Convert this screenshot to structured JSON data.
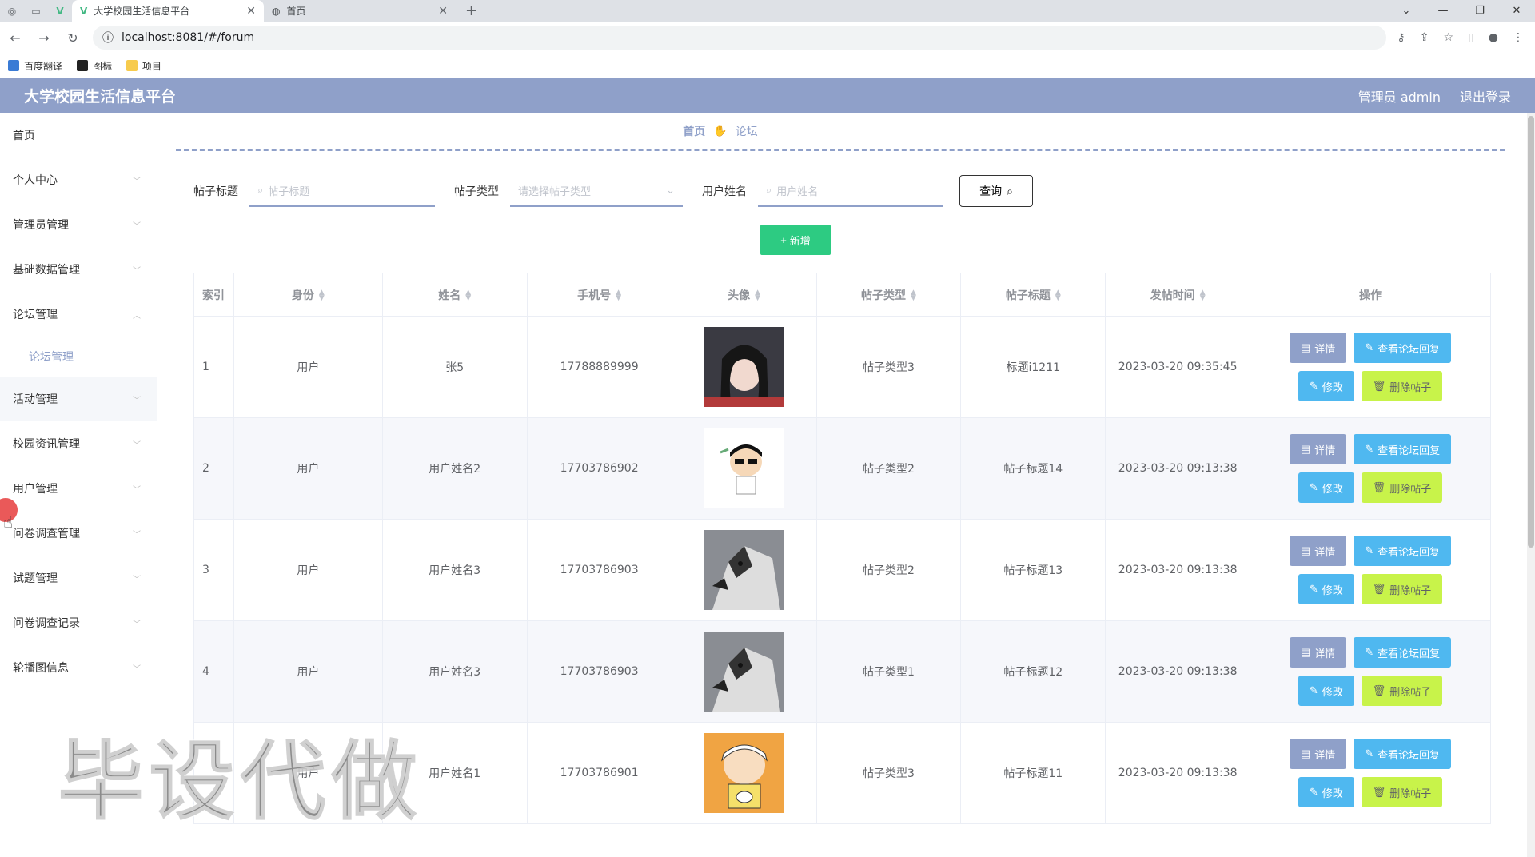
{
  "browser": {
    "tabs": [
      {
        "title": "大学校园生活信息平台",
        "active": true
      },
      {
        "title": "首页",
        "active": false
      }
    ],
    "url": "localhost:8081/#/forum",
    "bookmarks": [
      "百度翻译",
      "图标",
      "项目"
    ]
  },
  "header": {
    "title": "大学校园生活信息平台",
    "user": "管理员 admin",
    "logout": "退出登录"
  },
  "sidebar": {
    "items": [
      "首页",
      "个人中心",
      "管理员管理",
      "基础数据管理",
      "论坛管理",
      "论坛管理",
      "活动管理",
      "校园资讯管理",
      "用户管理",
      "问卷调查管理",
      "试题管理",
      "问卷调查记录",
      "轮播图信息"
    ]
  },
  "breadcrumb": {
    "home": "首页",
    "current": "论坛"
  },
  "search": {
    "title_label": "帖子标题",
    "title_placeholder": "帖子标题",
    "type_label": "帖子类型",
    "type_placeholder": "请选择帖子类型",
    "user_label": "用户姓名",
    "user_placeholder": "用户姓名",
    "query_label": "查询"
  },
  "add_label": "新增",
  "table": {
    "headers": [
      "索引",
      "身份",
      "姓名",
      "手机号",
      "头像",
      "帖子类型",
      "帖子标题",
      "发帖时间",
      "操作"
    ],
    "rows": [
      {
        "index": "1",
        "role": "用户",
        "name": "张5",
        "phone": "17788889999",
        "type": "帖子类型3",
        "title": "标题i1211",
        "time": "2023-03-20 09:35:45"
      },
      {
        "index": "2",
        "role": "用户",
        "name": "用户姓名2",
        "phone": "17703786902",
        "type": "帖子类型2",
        "title": "帖子标题14",
        "time": "2023-03-20 09:13:38"
      },
      {
        "index": "3",
        "role": "用户",
        "name": "用户姓名3",
        "phone": "17703786903",
        "type": "帖子类型2",
        "title": "帖子标题13",
        "time": "2023-03-20 09:13:38"
      },
      {
        "index": "4",
        "role": "用户",
        "name": "用户姓名3",
        "phone": "17703786903",
        "type": "帖子类型1",
        "title": "帖子标题12",
        "time": "2023-03-20 09:13:38"
      },
      {
        "index": "",
        "role": "用户",
        "name": "用户姓名1",
        "phone": "17703786901",
        "type": "帖子类型3",
        "title": "帖子标题11",
        "time": "2023-03-20 09:13:38"
      }
    ],
    "ops": {
      "detail": "详情",
      "reply": "查看论坛回复",
      "edit": "修改",
      "delete": "删除帖子"
    }
  },
  "watermark": "毕设代做",
  "colors": {
    "header": "#8fa0c9",
    "add": "#2dcb82",
    "reply": "#4fb8f0",
    "delete": "#c8f34a"
  }
}
